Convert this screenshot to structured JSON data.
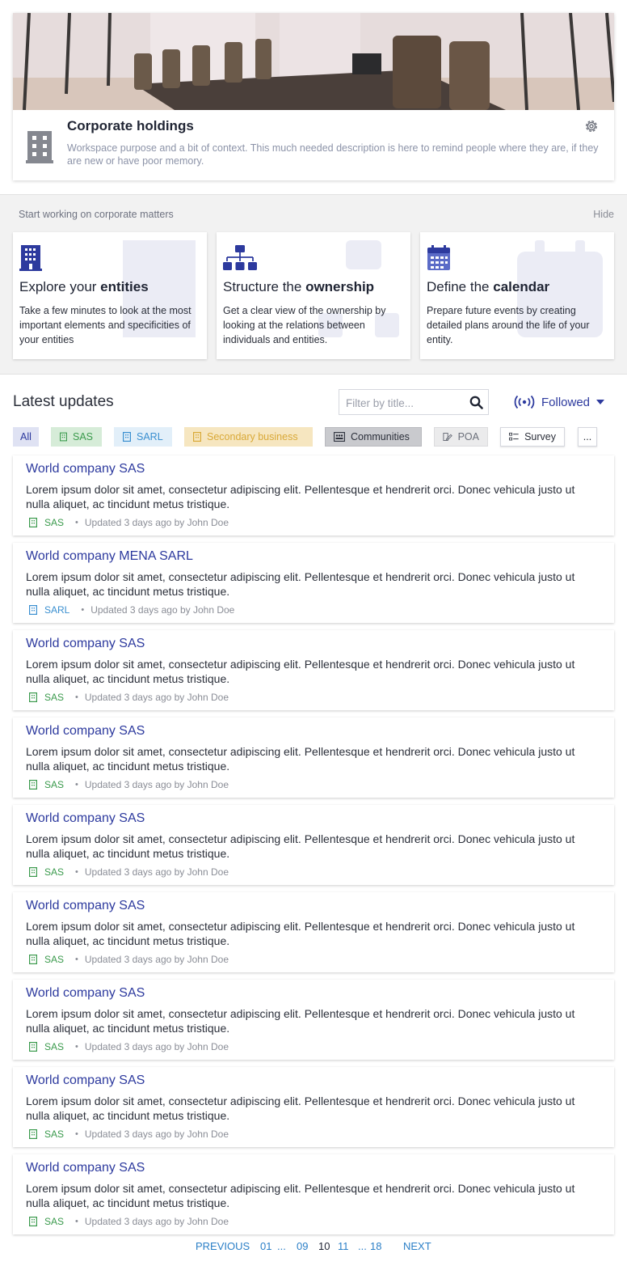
{
  "header": {
    "title": "Corporate holdings",
    "description": "Workspace purpose and a bit of context. This much needed description is here to remind people where they are, if they are new or have poor memory."
  },
  "start_panel": {
    "title": "Start working on corporate matters",
    "hide_label": "Hide",
    "cards": [
      {
        "heading_prefix": "Explore your ",
        "heading_bold": "entities",
        "text": "Take a few minutes to look at the most important elements and specificities of your entities",
        "icon": "building-icon"
      },
      {
        "heading_prefix": "Structure the ",
        "heading_bold": "ownership",
        "text": "Get  a clear view of the ownership by looking at the relations between individuals and entities.",
        "icon": "org-chart-icon"
      },
      {
        "heading_prefix": "Define the ",
        "heading_bold": "calendar",
        "text": "Prepare future events by creating detailed plans around the life of your entity.",
        "icon": "calendar-icon"
      }
    ]
  },
  "latest": {
    "title": "Latest updates",
    "filter_placeholder": "Filter by title...",
    "followed_label": "Followed",
    "chips": [
      {
        "label": "All"
      },
      {
        "label": "SAS"
      },
      {
        "label": "SARL"
      },
      {
        "label": "Secondary business"
      },
      {
        "label": "Communities"
      },
      {
        "label": "POA"
      },
      {
        "label": "Survey"
      },
      {
        "label": "..."
      }
    ],
    "items": [
      {
        "title": "World company SAS",
        "body": "Lorem ipsum dolor sit amet, consectetur adipiscing elit. Pellentesque et hendrerit orci. Donec vehicula justo ut nulla aliquet, ac tincidunt metus tristique.",
        "tag": "SAS",
        "meta": "Updated 3 days ago by John Doe"
      },
      {
        "title": "World company MENA SARL",
        "body": "Lorem ipsum dolor sit amet, consectetur adipiscing elit. Pellentesque et hendrerit orci. Donec vehicula justo ut nulla aliquet, ac tincidunt metus tristique.",
        "tag": "SARL",
        "meta": "Updated 3 days ago by John Doe"
      },
      {
        "title": "World company SAS",
        "body": "Lorem ipsum dolor sit amet, consectetur adipiscing elit. Pellentesque et hendrerit orci. Donec vehicula justo ut nulla aliquet, ac tincidunt metus tristique.",
        "tag": "SAS",
        "meta": "Updated 3 days ago by John Doe"
      },
      {
        "title": "World company SAS",
        "body": "Lorem ipsum dolor sit amet, consectetur adipiscing elit. Pellentesque et hendrerit orci. Donec vehicula justo ut nulla aliquet, ac tincidunt metus tristique.",
        "tag": "SAS",
        "meta": "Updated 3 days ago by John Doe"
      },
      {
        "title": "World company SAS",
        "body": "Lorem ipsum dolor sit amet, consectetur adipiscing elit. Pellentesque et hendrerit orci. Donec vehicula justo ut nulla aliquet, ac tincidunt metus tristique.",
        "tag": "SAS",
        "meta": "Updated 3 days ago by John Doe"
      },
      {
        "title": "World company SAS",
        "body": "Lorem ipsum dolor sit amet, consectetur adipiscing elit. Pellentesque et hendrerit orci. Donec vehicula justo ut nulla aliquet, ac tincidunt metus tristique.",
        "tag": "SAS",
        "meta": "Updated 3 days ago by John Doe"
      },
      {
        "title": "World company SAS",
        "body": "Lorem ipsum dolor sit amet, consectetur adipiscing elit. Pellentesque et hendrerit orci. Donec vehicula justo ut nulla aliquet, ac tincidunt metus tristique.",
        "tag": "SAS",
        "meta": "Updated 3 days ago by John Doe"
      },
      {
        "title": "World company SAS",
        "body": "Lorem ipsum dolor sit amet, consectetur adipiscing elit. Pellentesque et hendrerit orci. Donec vehicula justo ut nulla aliquet, ac tincidunt metus tristique.",
        "tag": "SAS",
        "meta": "Updated 3 days ago by John Doe"
      },
      {
        "title": "World company SAS",
        "body": "Lorem ipsum dolor sit amet, consectetur adipiscing elit. Pellentesque et hendrerit orci. Donec vehicula justo ut nulla aliquet, ac tincidunt metus tristique.",
        "tag": "SAS",
        "meta": "Updated 3 days ago by John Doe"
      }
    ]
  },
  "pagination": {
    "previous": "PREVIOUS",
    "first": "01",
    "ellipsis_left": "...",
    "prev_page": "09",
    "current": "10",
    "next_page": "11",
    "ellipsis_right": "...",
    "last": "18",
    "next": "NEXT"
  },
  "colors": {
    "primary": "#2d3a9e",
    "sas_green": "#3a9a4c",
    "sarl_blue": "#3a8fd0",
    "secondary_yellow": "#d9a938",
    "link_blue": "#2b7fc7"
  }
}
